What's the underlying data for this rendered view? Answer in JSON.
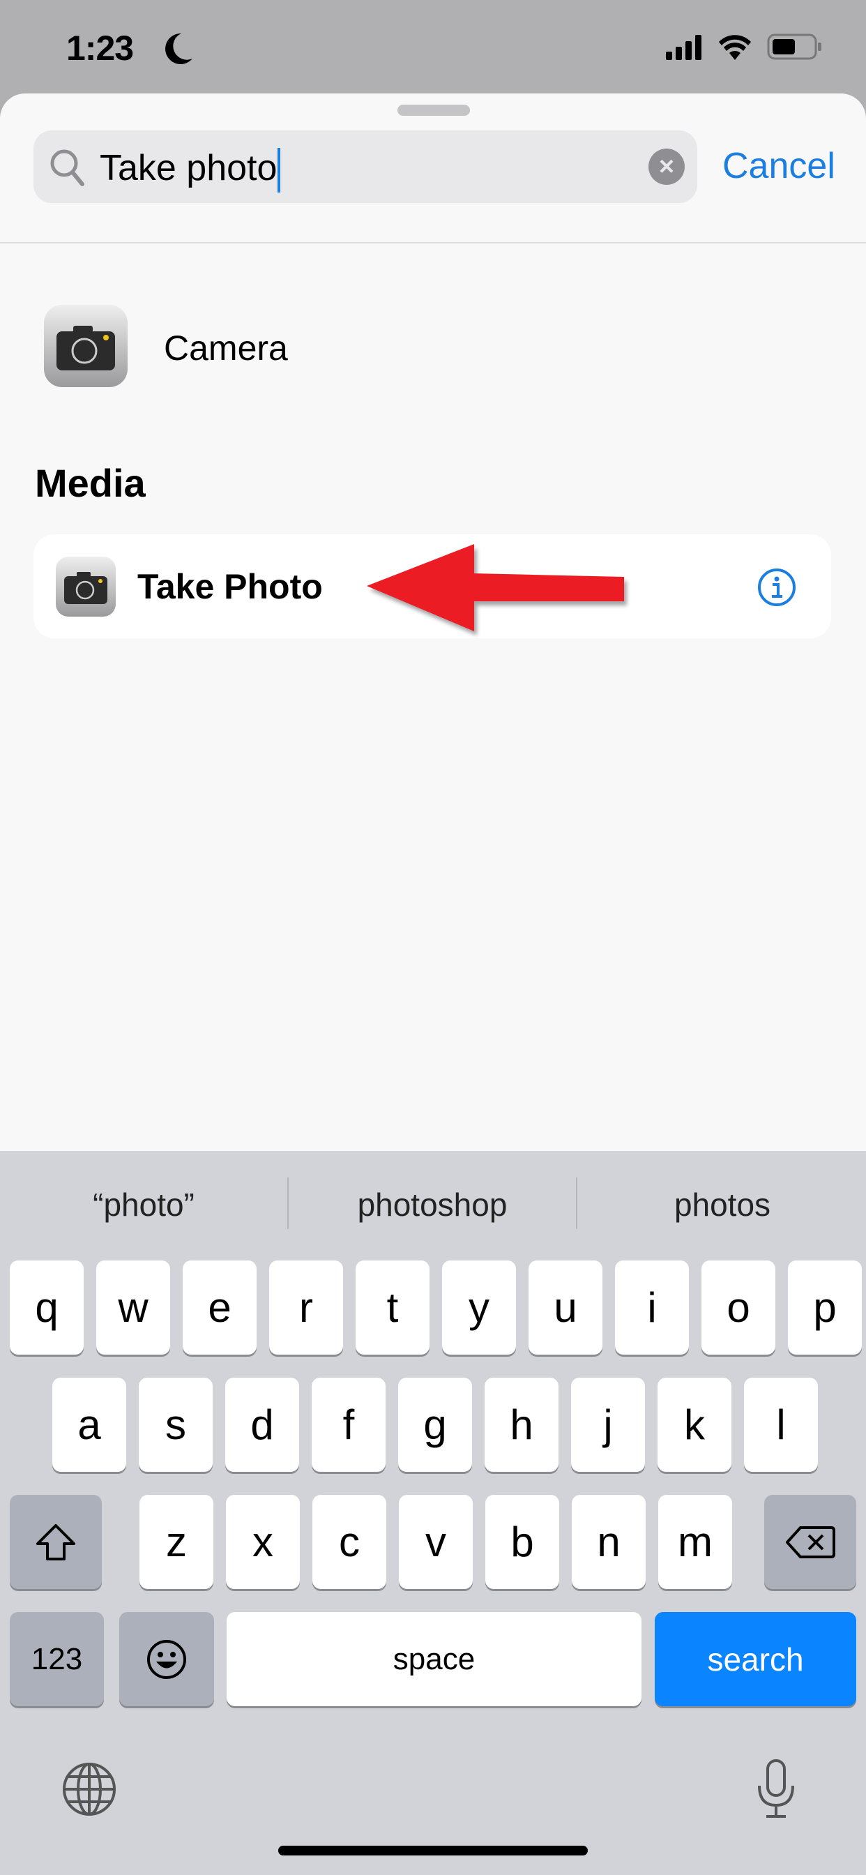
{
  "status_bar": {
    "time": "1:23",
    "focus_icon": "moon-icon",
    "signal_icon": "cellular-signal-icon",
    "wifi_icon": "wifi-icon",
    "battery_icon": "battery-icon"
  },
  "search": {
    "value": "Take photo",
    "clear_icon": "clear-icon",
    "cancel_label": "Cancel"
  },
  "results": {
    "app": {
      "label": "Camera",
      "icon": "camera-app-icon"
    },
    "section_title": "Media",
    "actions": [
      {
        "label": "Take Photo",
        "icon": "camera-app-icon",
        "info_icon": "info-icon"
      }
    ]
  },
  "annotation": {
    "arrow_color": "#ec1c24"
  },
  "keyboard": {
    "suggestions": [
      "“photo”",
      "photoshop",
      "photos"
    ],
    "rows": [
      [
        "q",
        "w",
        "e",
        "r",
        "t",
        "y",
        "u",
        "i",
        "o",
        "p"
      ],
      [
        "a",
        "s",
        "d",
        "f",
        "g",
        "h",
        "j",
        "k",
        "l"
      ],
      [
        "z",
        "x",
        "c",
        "v",
        "b",
        "n",
        "m"
      ]
    ],
    "shift_icon": "shift-icon",
    "delete_icon": "delete-icon",
    "numbers_label": "123",
    "emoji_icon": "emoji-icon",
    "space_label": "space",
    "return_label": "search",
    "globe_icon": "globe-icon",
    "mic_icon": "microphone-icon"
  },
  "colors": {
    "accent": "#1a7fe0",
    "return_key": "#0a84ff"
  }
}
